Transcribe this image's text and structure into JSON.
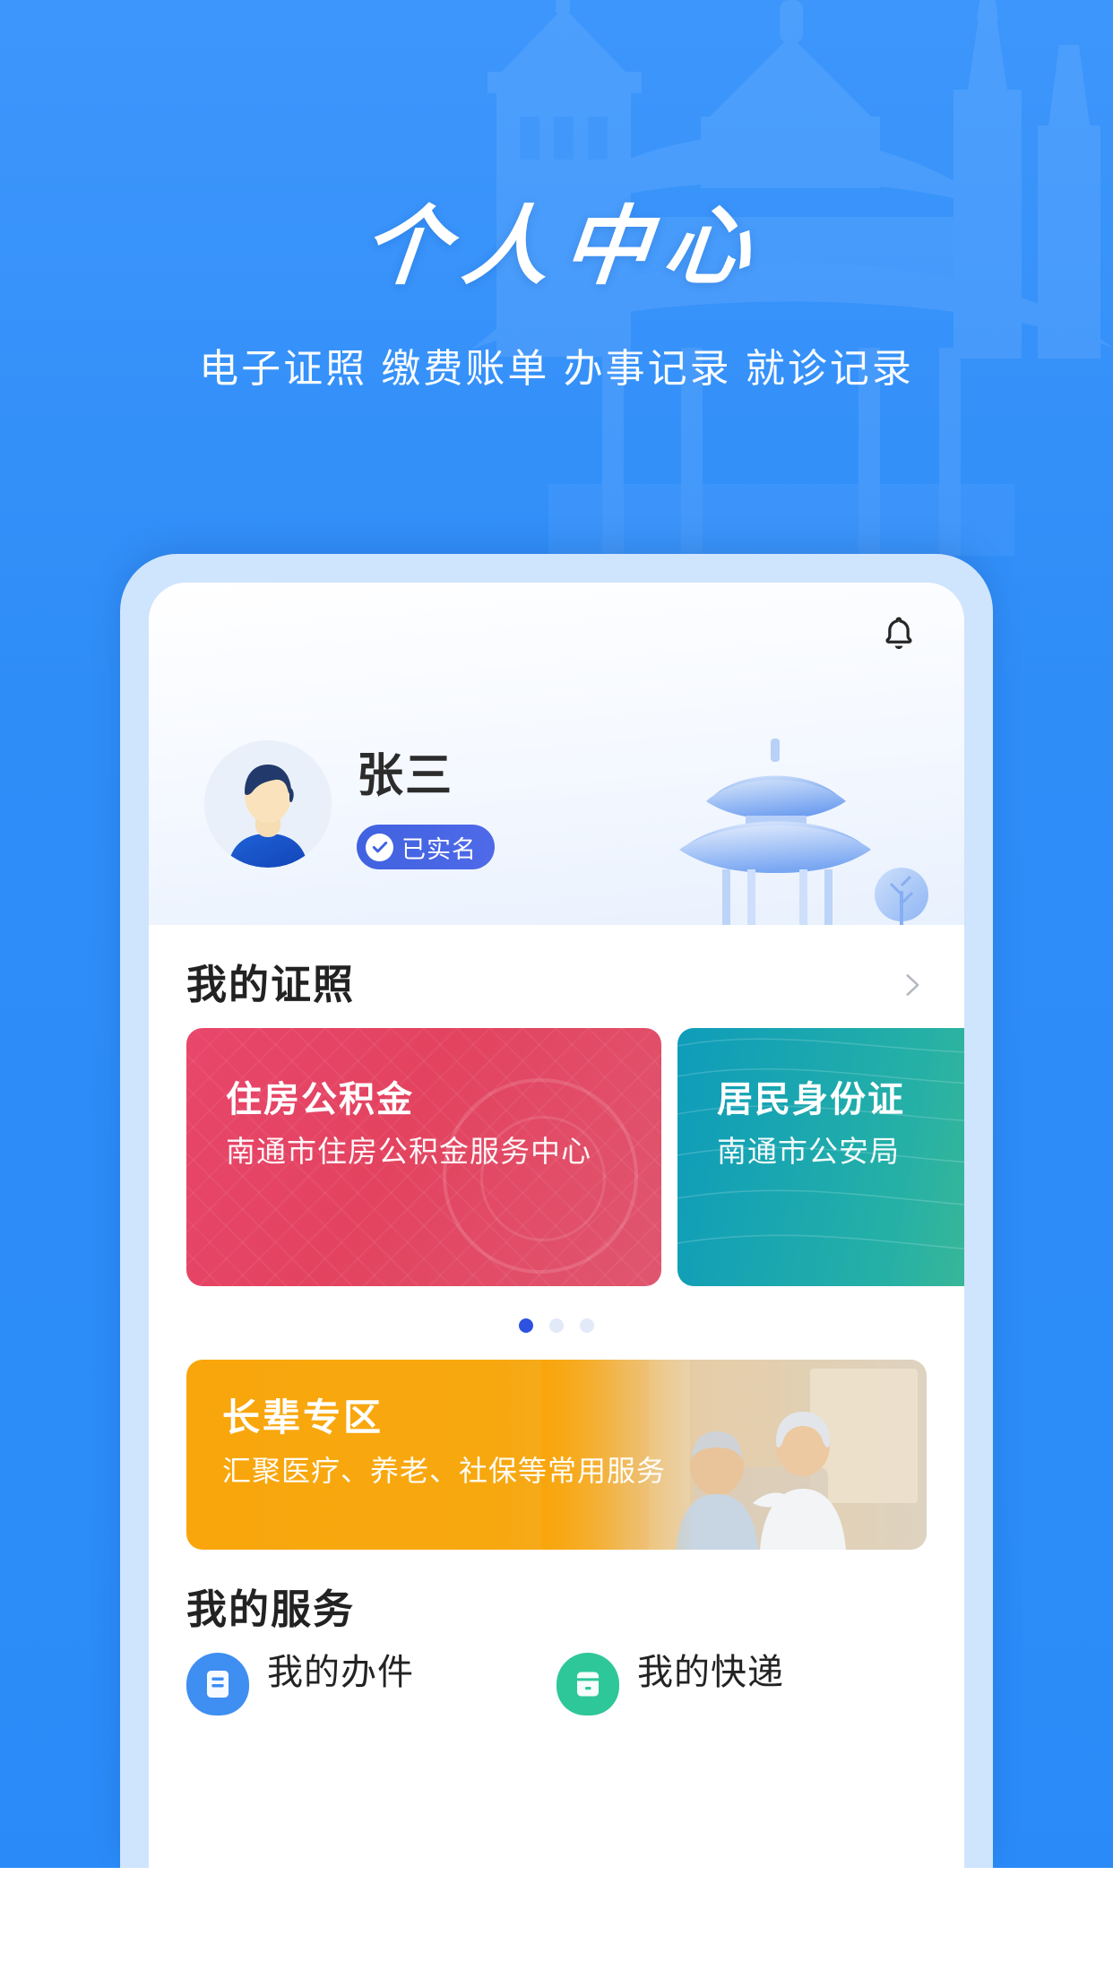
{
  "hero": {
    "title": "个人中心",
    "subtitle": "电子证照 缴费账单 办事记录 就诊记录",
    "bg_color": "#2b8cf7",
    "temple_watermark": "chinese-temple-silhouette"
  },
  "profile": {
    "bell_icon": "bell-icon",
    "avatar_icon": "user-avatar",
    "name": "张三",
    "verified_label": "已实名",
    "verified_icon": "check-circle-icon",
    "verified_color": "#4062e0",
    "pavilion_icon": "pagoda-illustration"
  },
  "licenses": {
    "section_title": "我的证照",
    "more_icon": "chevron-right-icon",
    "cards": [
      {
        "title": "住房公积金",
        "org": "南通市住房公积金服务中心",
        "color": "#e3435f",
        "seal": "housing-fund-seal"
      },
      {
        "title": "居民身份证",
        "org": "南通市公安局",
        "color": "#25b0a6",
        "seal": ""
      }
    ],
    "pagination": {
      "total": 3,
      "active": 1
    }
  },
  "banner": {
    "title": "长辈专区",
    "subtitle": "汇聚医疗、养老、社保等常用服务",
    "color": "#f9a60c",
    "photo": "elderly-couple-photo"
  },
  "services": {
    "section_title": "我的服务",
    "items": [
      {
        "name": "我的办件",
        "desc": "",
        "icon": "document-icon",
        "color": "#3f8ef2"
      },
      {
        "name": "我的快递",
        "desc": "",
        "icon": "package-icon",
        "color": "#2ec79a"
      }
    ]
  }
}
